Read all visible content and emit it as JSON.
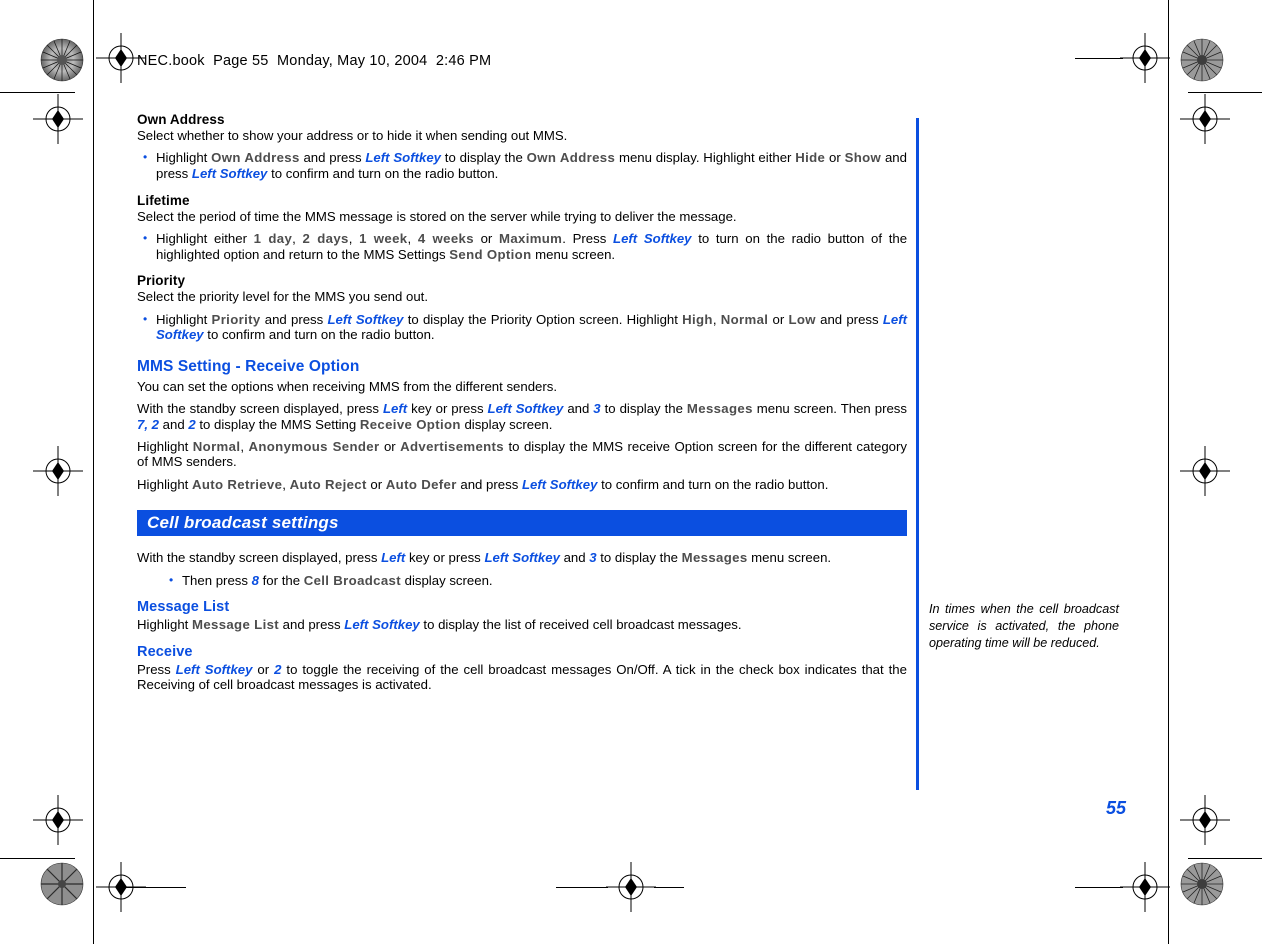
{
  "print_header": {
    "text": "NEC.book  Page 55  Monday, May 10, 2004  2:46 PM"
  },
  "page_number": "55",
  "colors": {
    "accent_blue": "#0b4fe0",
    "key_term_gray": "#4d4d4d",
    "banner_text": "#ffffff"
  },
  "sections": [
    {
      "id": "own-address",
      "heading": "Own Address",
      "intro": "Select whether to show your address or to hide it when sending out MMS.",
      "bullet_runs": [
        {
          "t": "Highlight ",
          "s": "plain"
        },
        {
          "t": "Own Address",
          "s": "gray"
        },
        {
          "t": " and press ",
          "s": "plain"
        },
        {
          "t": "Left Softkey",
          "s": "blue"
        },
        {
          "t": " to display the ",
          "s": "plain"
        },
        {
          "t": "Own Address",
          "s": "gray"
        },
        {
          "t": " menu display. Highlight either ",
          "s": "plain"
        },
        {
          "t": "Hide",
          "s": "gray"
        },
        {
          "t": " or ",
          "s": "plain"
        },
        {
          "t": "Show",
          "s": "gray"
        },
        {
          "t": " and press ",
          "s": "plain"
        },
        {
          "t": "Left Softkey",
          "s": "blue"
        },
        {
          "t": " to confirm and turn on the radio button.",
          "s": "plain"
        }
      ]
    },
    {
      "id": "lifetime",
      "heading": "Lifetime",
      "intro": "Select the period of time the MMS message is stored on the server while trying to deliver the message.",
      "bullet_runs": [
        {
          "t": "Highlight either ",
          "s": "plain"
        },
        {
          "t": "1 day",
          "s": "gray"
        },
        {
          "t": ", ",
          "s": "plain"
        },
        {
          "t": "2 days",
          "s": "gray"
        },
        {
          "t": ", ",
          "s": "plain"
        },
        {
          "t": "1 week",
          "s": "gray"
        },
        {
          "t": ", ",
          "s": "plain"
        },
        {
          "t": "4 weeks",
          "s": "gray"
        },
        {
          "t": " or ",
          "s": "plain"
        },
        {
          "t": "Maximum",
          "s": "gray"
        },
        {
          "t": ". Press ",
          "s": "plain"
        },
        {
          "t": "Left Softkey",
          "s": "blue"
        },
        {
          "t": " to turn on the radio button of the highlighted option and return to the MMS Settings ",
          "s": "plain"
        },
        {
          "t": "Send Option",
          "s": "gray"
        },
        {
          "t": " menu screen.",
          "s": "plain"
        }
      ]
    },
    {
      "id": "priority",
      "heading": "Priority",
      "intro": "Select the priority level for the MMS you send out.",
      "bullet_runs": [
        {
          "t": "Highlight ",
          "s": "plain"
        },
        {
          "t": "Priority",
          "s": "gray"
        },
        {
          "t": " and press ",
          "s": "plain"
        },
        {
          "t": "Left Softkey",
          "s": "blue"
        },
        {
          "t": " to display the Priority Option screen. Highlight ",
          "s": "plain"
        },
        {
          "t": "High",
          "s": "gray"
        },
        {
          "t": ", ",
          "s": "plain"
        },
        {
          "t": "Normal",
          "s": "gray"
        },
        {
          "t": " or ",
          "s": "plain"
        },
        {
          "t": "Low",
          "s": "gray"
        },
        {
          "t": " and press ",
          "s": "plain"
        },
        {
          "t": "Left Softkey",
          "s": "blue"
        },
        {
          "t": " to confirm and turn on the radio button.",
          "s": "plain"
        }
      ]
    }
  ],
  "receive_option": {
    "heading": "MMS Setting - Receive Option",
    "intro": "You can set the options when receiving MMS from the different senders.",
    "para1_runs": [
      {
        "t": "With the standby screen displayed, press ",
        "s": "plain"
      },
      {
        "t": "Left",
        "s": "blue"
      },
      {
        "t": " key or press ",
        "s": "plain"
      },
      {
        "t": "Left Softkey",
        "s": "blue"
      },
      {
        "t": " and ",
        "s": "plain"
      },
      {
        "t": "3",
        "s": "blue"
      },
      {
        "t": " to display the ",
        "s": "plain"
      },
      {
        "t": "Messages",
        "s": "gray"
      },
      {
        "t": " menu screen. Then press ",
        "s": "plain"
      },
      {
        "t": "7, 2",
        "s": "blue"
      },
      {
        "t": " and ",
        "s": "plain"
      },
      {
        "t": "2",
        "s": "blue"
      },
      {
        "t": " to display the MMS Setting ",
        "s": "plain"
      },
      {
        "t": "Receive Option",
        "s": "gray"
      },
      {
        "t": " display screen.",
        "s": "plain"
      }
    ],
    "para2_runs": [
      {
        "t": "Highlight ",
        "s": "plain"
      },
      {
        "t": "Normal",
        "s": "gray"
      },
      {
        "t": ", ",
        "s": "plain"
      },
      {
        "t": "Anonymous Sender",
        "s": "gray"
      },
      {
        "t": " or ",
        "s": "plain"
      },
      {
        "t": "Advertisements",
        "s": "gray"
      },
      {
        "t": " to display the MMS receive Option screen for the different category of MMS senders.",
        "s": "plain"
      }
    ],
    "para3_runs": [
      {
        "t": "Highlight ",
        "s": "plain"
      },
      {
        "t": "Auto Retrieve",
        "s": "gray"
      },
      {
        "t": ", ",
        "s": "plain"
      },
      {
        "t": "Auto Reject",
        "s": "gray"
      },
      {
        "t": " or ",
        "s": "plain"
      },
      {
        "t": "Auto Defer",
        "s": "gray"
      },
      {
        "t": " and press ",
        "s": "plain"
      },
      {
        "t": "Left Softkey",
        "s": "blue"
      },
      {
        "t": " to confirm and turn on the radio button.",
        "s": "plain"
      }
    ]
  },
  "banner": {
    "title": "Cell broadcast settings"
  },
  "cell_broadcast": {
    "para1_runs": [
      {
        "t": "With the standby screen displayed, press ",
        "s": "plain"
      },
      {
        "t": "Left",
        "s": "blue"
      },
      {
        "t": " key or press ",
        "s": "plain"
      },
      {
        "t": "Left Softkey",
        "s": "blue"
      },
      {
        "t": " and ",
        "s": "plain"
      },
      {
        "t": "3",
        "s": "blue"
      },
      {
        "t": " to display the ",
        "s": "plain"
      },
      {
        "t": "Messages",
        "s": "gray"
      },
      {
        "t": " menu screen.",
        "s": "plain"
      }
    ],
    "bullet_runs": [
      {
        "t": "Then press ",
        "s": "plain"
      },
      {
        "t": "8",
        "s": "blue"
      },
      {
        "t": " for the ",
        "s": "plain"
      },
      {
        "t": "Cell Broadcast",
        "s": "gray"
      },
      {
        "t": " display screen.",
        "s": "plain"
      }
    ],
    "message_list": {
      "heading": "Message List",
      "body_runs": [
        {
          "t": "Highlight ",
          "s": "plain"
        },
        {
          "t": "Message List",
          "s": "gray"
        },
        {
          "t": " and press ",
          "s": "plain"
        },
        {
          "t": "Left Softkey",
          "s": "blue"
        },
        {
          "t": " to display the list of received cell broadcast messages.",
          "s": "plain"
        }
      ]
    },
    "receive": {
      "heading": "Receive",
      "body_runs": [
        {
          "t": "Press ",
          "s": "plain"
        },
        {
          "t": "Left Softkey",
          "s": "blue"
        },
        {
          "t": " or ",
          "s": "plain"
        },
        {
          "t": "2",
          "s": "blue"
        },
        {
          "t": " to toggle the receiving of the cell broadcast messages On/Off. A tick in the check box indicates that the Receiving of cell broadcast messages is activated.",
          "s": "plain"
        }
      ]
    }
  },
  "margin_note": {
    "text": "In times when the cell broadcast service is activated, the phone operating time will be reduced."
  }
}
